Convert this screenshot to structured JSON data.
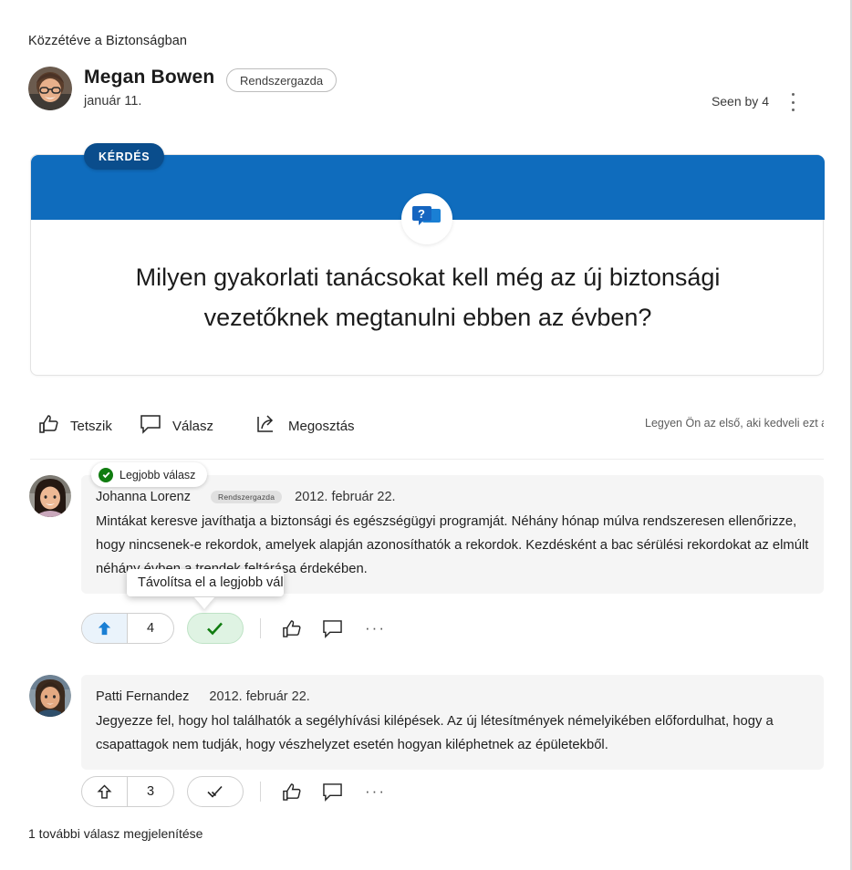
{
  "post": {
    "posted_in": "Közzétéve a Biztonságban",
    "author": "Megan Bowen",
    "author_role": "Rendszergazda",
    "date": "január 11.",
    "seen_by": "Seen by 4",
    "more_icon": "kebab-menu-icon",
    "card": {
      "badge": "KÉRDÉS",
      "icon": "question-bubble-icon",
      "banner_color": "#0f6cbd",
      "badge_color": "#0a4d8c",
      "question": "Milyen gyakorlati tanácsokat kell még az új biztonsági vezetőknek megtanulni ebben az évben?"
    }
  },
  "actions": {
    "like": "Tetszik",
    "reply": "Válasz",
    "share": "Megosztás",
    "like_icon": "thumbs-up-icon",
    "reply_icon": "comment-bubble-icon",
    "share_icon": "share-arrow-icon",
    "first_like_hint": "Legyen Ön az első, aki kedveli ezt a"
  },
  "tooltip": {
    "text": "Távolítsa el a legjobb választ"
  },
  "answers": [
    {
      "best_badge": "Legjobb válasz",
      "best_badge_icon": "green-check-circle-icon",
      "name": "Johanna Lorenz",
      "role": "Rendszergazda",
      "date": "2012. február 22.",
      "text": "Mintákat keresve javíthatja a biztonsági és egészségügyi programját. Néhány hónap múlva rendszeresen ellenőrizze, hogy nincsenek-e rekordok, amelyek alapján azonosíthatók a rekordok. Kezdésként a bac sérülési rekordokat az elmúlt néhány évben a trendek feltárása érdekében.",
      "upvotes": "4",
      "upvoted": true,
      "marked_best": true,
      "upvote_icon": "upvote-arrow-icon",
      "check_icon": "check-mark-icon",
      "like_icon": "thumbs-up-icon",
      "comment_icon": "comment-bubble-icon",
      "more_icon": "ellipsis-icon"
    },
    {
      "name": "Patti  Fernandez",
      "date": "2012. február 22.",
      "text": "Jegyezze fel, hogy hol találhatók a segélyhívási kilépések. Az új létesítmények némelyikében előfordulhat, hogy a csapattagok nem tudják, hogy vészhelyzet esetén hogyan kiléphetnek az épületekből.",
      "upvotes": "3",
      "upvoted": false,
      "marked_best": false,
      "upvote_icon": "upvote-arrow-icon",
      "check_icon": "check-mark-icon",
      "like_icon": "thumbs-up-icon",
      "comment_icon": "comment-bubble-icon",
      "more_icon": "ellipsis-icon"
    }
  ],
  "footer": {
    "show_more": "1 további válasz megjelenítése"
  }
}
